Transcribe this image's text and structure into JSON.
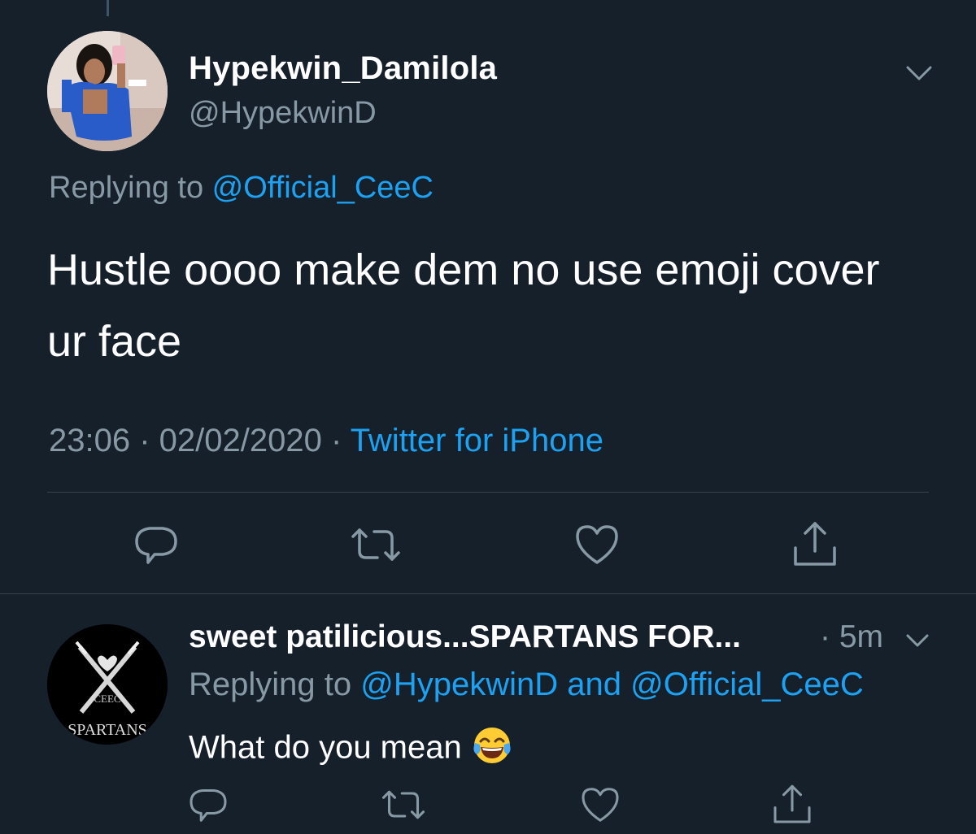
{
  "main_tweet": {
    "display_name": "Hypekwin_Damilola",
    "handle": "@HypekwinD",
    "replying_prefix": "Replying to ",
    "replying_to": "@Official_CeeC",
    "text": "Hustle oooo make dem no use emoji cover ur face",
    "time": "23:06",
    "date": "02/02/2020",
    "separator": " · ",
    "source": "Twitter for iPhone"
  },
  "reply_tweet": {
    "display_name": "sweet patilicious...SPARTANS FOR...",
    "time": "· 5m",
    "replying_prefix": "Replying to ",
    "replying_to_1": "@HypekwinD",
    "replying_and": " and ",
    "replying_to_2": "@Official_CeeC",
    "text": "What do you mean",
    "emoji": "face-with-tears-of-joy",
    "avatar_text_top": "CEEC",
    "avatar_text_bottom": "SPARTANS"
  },
  "actions": [
    "reply-icon",
    "retweet-icon",
    "like-icon",
    "share-icon"
  ],
  "colors": {
    "background": "#15202b",
    "text": "#ffffff",
    "secondary": "#8899a6",
    "link": "#1da1f2",
    "divider": "#38444d"
  }
}
